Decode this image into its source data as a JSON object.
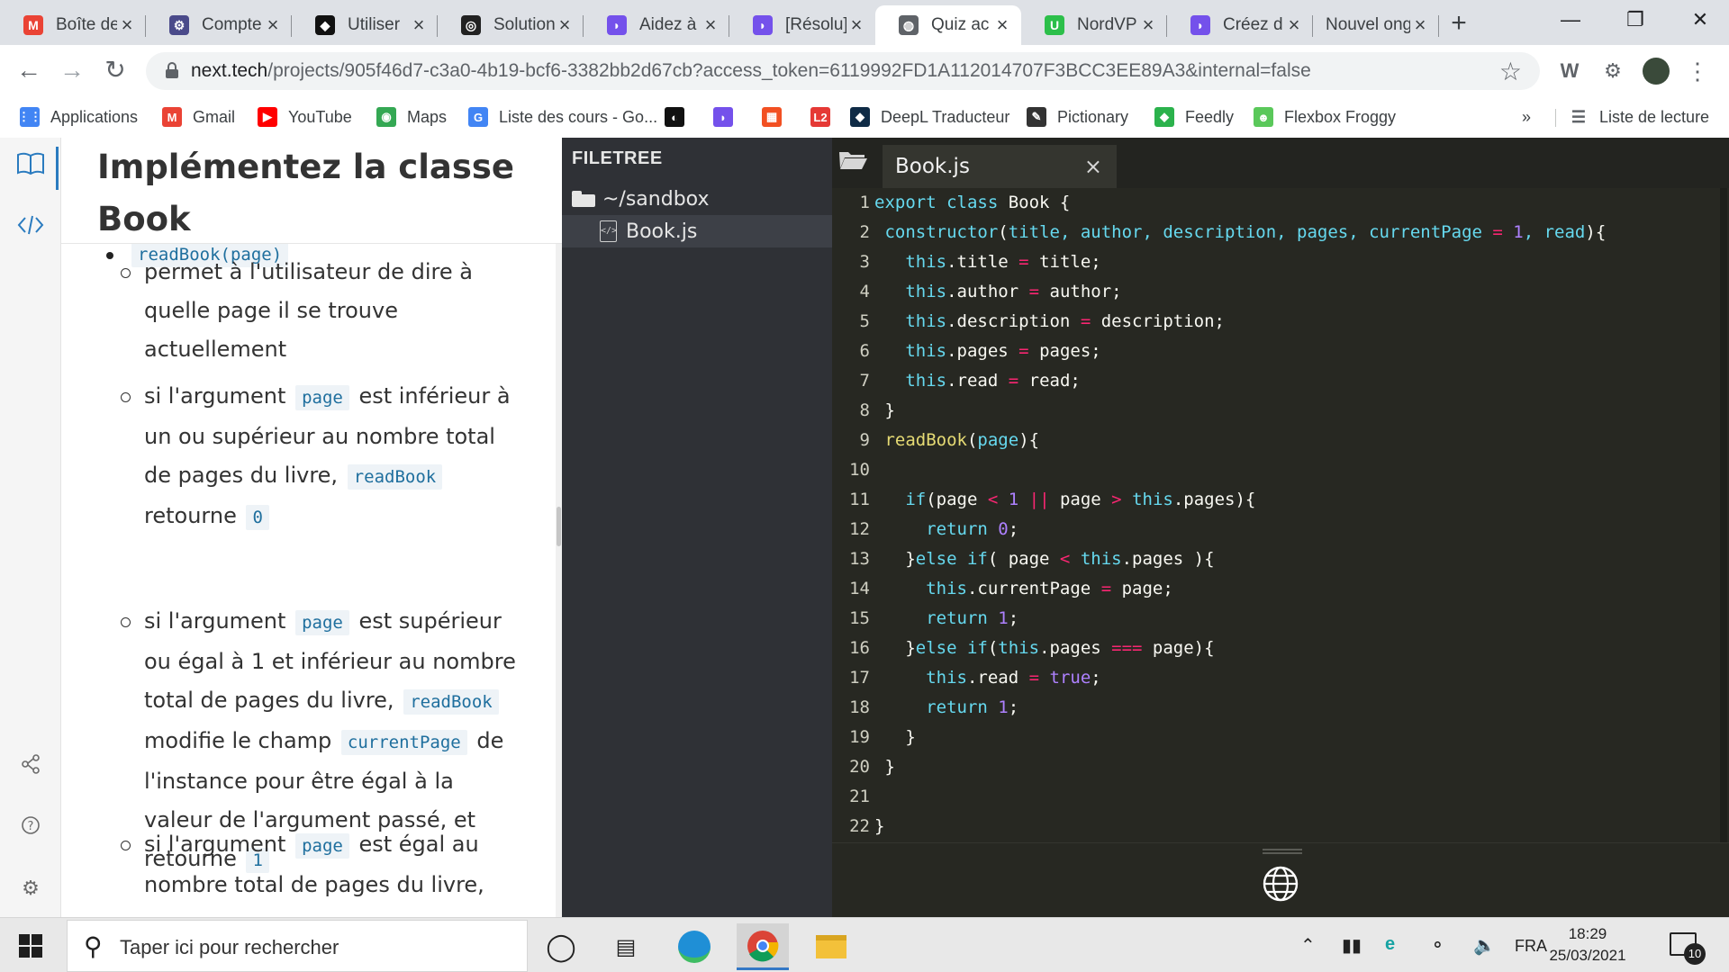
{
  "browser": {
    "tabs": [
      {
        "title": "Boîte de",
        "icon": "gmail-icon",
        "color": "#ea4335",
        "glyph": "M"
      },
      {
        "title": "Compte",
        "icon": "account-icon",
        "color": "#4a4a8a",
        "glyph": "⚙"
      },
      {
        "title": "Utiliser",
        "icon": "site-icon",
        "color": "#111111",
        "glyph": "◆"
      },
      {
        "title": "Solution",
        "icon": "codesandbox-icon",
        "color": "#222222",
        "glyph": "◎"
      },
      {
        "title": "Aidez à",
        "icon": "openclassrooms-icon",
        "color": "#7451eb",
        "glyph": "◗"
      },
      {
        "title": "[Résolu]",
        "icon": "openclassrooms-icon",
        "color": "#7451eb",
        "glyph": "◗"
      },
      {
        "title": "Quiz ac",
        "icon": "globe-icon",
        "color": "#5f6368",
        "glyph": "◍",
        "active": true
      },
      {
        "title": "NordVP",
        "icon": "nordvpn-icon",
        "color": "#2cbf4a",
        "glyph": "U"
      },
      {
        "title": "Créez d",
        "icon": "openclassrooms-icon",
        "color": "#7451eb",
        "glyph": "◗"
      },
      {
        "title": "Nouvel ong",
        "icon": "",
        "color": "",
        "glyph": ""
      }
    ],
    "new_tab": "+",
    "window_controls": {
      "minimize": "—",
      "restore": "❐",
      "close": "✕"
    },
    "url": {
      "host": "next.tech",
      "path": "/projects/905f46d7-c3a0-4b19-bcf6-3382bb2d67cb?access_token=6119992FD1A112014707F3BCC3EE89A3&internal=false"
    },
    "bookmarks": [
      {
        "label": "Applications",
        "icon": "apps-grid-icon",
        "color": "#4285f4",
        "glyph": "⋮⋮"
      },
      {
        "label": "Gmail",
        "icon": "gmail-icon",
        "color": "#ea4335",
        "glyph": "M"
      },
      {
        "label": "YouTube",
        "icon": "youtube-icon",
        "color": "#ff0000",
        "glyph": "▶"
      },
      {
        "label": "Maps",
        "icon": "maps-icon",
        "color": "#34a853",
        "glyph": "◉"
      },
      {
        "label": "Liste des cours - Go...",
        "icon": "google-icon",
        "color": "#4285f4",
        "glyph": "G"
      },
      {
        "label": "",
        "icon": "github-icon",
        "color": "#111111",
        "glyph": "◐"
      },
      {
        "label": "",
        "icon": "openclassrooms-icon",
        "color": "#7451eb",
        "glyph": "◗"
      },
      {
        "label": "",
        "icon": "microsoft-icon",
        "color": "#f25022",
        "glyph": "▦"
      },
      {
        "label": "",
        "icon": "l2-icon",
        "color": "#e53935",
        "glyph": "L2"
      },
      {
        "label": "DeepL Traducteur",
        "icon": "deepl-icon",
        "color": "#0f2b46",
        "glyph": "◆"
      },
      {
        "label": "Pictionary",
        "icon": "pictionary-icon",
        "color": "#333333",
        "glyph": "✎"
      },
      {
        "label": "Feedly",
        "icon": "feedly-icon",
        "color": "#2bb24c",
        "glyph": "◆"
      },
      {
        "label": "Flexbox Froggy",
        "icon": "froggy-icon",
        "color": "#5ac85a",
        "glyph": "☻"
      }
    ],
    "bookmarks_overflow": "»",
    "reading_list": "Liste de lecture"
  },
  "lesson": {
    "title": "Implémentez la classe Book",
    "method": "readBook(page)",
    "items": [
      {
        "parts": [
          {
            "t": "permet à l'utilisateur de dire à quelle page il se trouve actuellement"
          }
        ]
      },
      {
        "parts": [
          {
            "t": "si l'argument "
          },
          {
            "c": "page"
          },
          {
            "t": " est inférieur à un ou supérieur au nombre total de pages du livre, "
          },
          {
            "c": "readBook"
          },
          {
            "t": " retourne "
          },
          {
            "c": "0"
          }
        ]
      },
      {
        "parts": [
          {
            "t": "si l'argument "
          },
          {
            "c": "page"
          },
          {
            "t": " est supérieur ou égal à 1 et inférieur au nombre total de pages du livre, "
          },
          {
            "c": "readBook"
          },
          {
            "t": " modifie le champ "
          },
          {
            "c": "currentPage"
          },
          {
            "t": " de l'instance pour être égal à la valeur de l'argument passé, et retourne "
          },
          {
            "c": "1"
          }
        ]
      },
      {
        "parts": [
          {
            "t": "si l'argument "
          },
          {
            "c": "page"
          },
          {
            "t": " est égal au nombre total de pages du livre,"
          }
        ]
      }
    ]
  },
  "filetree": {
    "title": "FILETREE",
    "folder": "~/sandbox",
    "file": "Book.js"
  },
  "editor": {
    "tab": "Book.js",
    "close": "×",
    "lines": [
      [
        [
          "kw",
          "export "
        ],
        [
          "kw",
          "class "
        ],
        [
          "id",
          "Book "
        ],
        [
          "p",
          "{"
        ]
      ],
      [
        [
          "p",
          " "
        ],
        [
          "fn",
          "constructor"
        ],
        [
          "p",
          "("
        ],
        [
          "arg",
          "title, author, description, pages, currentPage "
        ],
        [
          "op",
          "= "
        ],
        [
          "num",
          "1"
        ],
        [
          "arg",
          ", read"
        ],
        [
          "p",
          "){"
        ]
      ],
      [
        [
          "p",
          "   "
        ],
        [
          "th",
          "this"
        ],
        [
          "p",
          ".title "
        ],
        [
          "op",
          "= "
        ],
        [
          "p",
          "title;"
        ]
      ],
      [
        [
          "p",
          "   "
        ],
        [
          "th",
          "this"
        ],
        [
          "p",
          ".author "
        ],
        [
          "op",
          "= "
        ],
        [
          "p",
          "author;"
        ]
      ],
      [
        [
          "p",
          "   "
        ],
        [
          "th",
          "this"
        ],
        [
          "p",
          ".description "
        ],
        [
          "op",
          "= "
        ],
        [
          "p",
          "description;"
        ]
      ],
      [
        [
          "p",
          "   "
        ],
        [
          "th",
          "this"
        ],
        [
          "p",
          ".pages "
        ],
        [
          "op",
          "= "
        ],
        [
          "p",
          "pages;"
        ]
      ],
      [
        [
          "p",
          "   "
        ],
        [
          "th",
          "this"
        ],
        [
          "p",
          ".read "
        ],
        [
          "op",
          "= "
        ],
        [
          "p",
          "read;"
        ]
      ],
      [
        [
          "p",
          " }"
        ]
      ],
      [
        [
          "p",
          " "
        ],
        [
          "fnname",
          "readBook"
        ],
        [
          "p",
          "("
        ],
        [
          "arg",
          "page"
        ],
        [
          "p",
          "){"
        ]
      ],
      [
        [
          "p",
          ""
        ]
      ],
      [
        [
          "p",
          "   "
        ],
        [
          "kw",
          "if"
        ],
        [
          "p",
          "(page "
        ],
        [
          "op",
          "< "
        ],
        [
          "num",
          "1 "
        ],
        [
          "op",
          "|| "
        ],
        [
          "p",
          "page "
        ],
        [
          "op",
          "> "
        ],
        [
          "th",
          "this"
        ],
        [
          "p",
          ".pages){"
        ]
      ],
      [
        [
          "p",
          "     "
        ],
        [
          "kw",
          "return "
        ],
        [
          "num",
          "0"
        ],
        [
          "p",
          ";"
        ]
      ],
      [
        [
          "p",
          "   }"
        ],
        [
          "kw",
          "else if"
        ],
        [
          "p",
          "( page "
        ],
        [
          "op",
          "< "
        ],
        [
          "th",
          "this"
        ],
        [
          "p",
          ".pages ){"
        ]
      ],
      [
        [
          "p",
          "     "
        ],
        [
          "th",
          "this"
        ],
        [
          "p",
          ".currentPage "
        ],
        [
          "op",
          "= "
        ],
        [
          "p",
          "page;"
        ]
      ],
      [
        [
          "p",
          "     "
        ],
        [
          "kw",
          "return "
        ],
        [
          "num",
          "1"
        ],
        [
          "p",
          ";"
        ]
      ],
      [
        [
          "p",
          "   }"
        ],
        [
          "kw",
          "else if"
        ],
        [
          "p",
          "("
        ],
        [
          "th",
          "this"
        ],
        [
          "p",
          ".pages "
        ],
        [
          "op",
          "=== "
        ],
        [
          "p",
          "page){"
        ]
      ],
      [
        [
          "p",
          "     "
        ],
        [
          "th",
          "this"
        ],
        [
          "p",
          ".read "
        ],
        [
          "op",
          "= "
        ],
        [
          "num",
          "true"
        ],
        [
          "p",
          ";"
        ]
      ],
      [
        [
          "p",
          "     "
        ],
        [
          "kw",
          "return "
        ],
        [
          "num",
          "1"
        ],
        [
          "p",
          ";"
        ]
      ],
      [
        [
          "p",
          "   }"
        ]
      ],
      [
        [
          "p",
          " }"
        ]
      ],
      [
        [
          "p",
          ""
        ]
      ],
      [
        [
          "p",
          "}"
        ]
      ]
    ]
  },
  "taskbar": {
    "search_placeholder": "Taper ici pour rechercher",
    "language": "FRA",
    "time": "18:29",
    "date": "25/03/2021",
    "notifications": "10"
  },
  "colors": {
    "kw": "#66d9ef",
    "fn": "#66d9ef",
    "fnname": "#e6db74",
    "id": "#f8f8f2",
    "arg": "#66d9ef",
    "op": "#f92672",
    "num": "#ae81ff",
    "th": "#66d9ef",
    "p": "#f8f8f2"
  }
}
